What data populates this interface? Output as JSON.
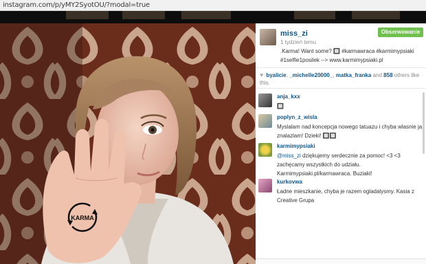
{
  "browser": {
    "url": "instagram.com/p/yMY2SyotOU/?modal=true"
  },
  "post": {
    "username": "miss_zi",
    "time": "1 tydzień temu",
    "follow_label": "Obserwowanie",
    "caption": ".Karma! Want some? 🔲 #karmawraca #karmimypsiaki #1selfie1posilek --> www.karmimypsiaki.pl",
    "palm_text": "KARMA",
    "likes": {
      "users": [
        "byalicie",
        "_michelle20000_",
        "matka_franka"
      ],
      "sep1": ", ",
      "sep2": ", ",
      "and_text": " and ",
      "others_count": "858",
      "others_text": " others like this."
    }
  },
  "comments": [
    {
      "user": "anja_kxx",
      "text": "🔲"
    },
    {
      "user": "poplyn_z_wisla",
      "text": "Myslalam nad koncepcja nowego tatuazu i chyba wlasnie ja znalazlam! Dzieki! 🔲🔲"
    },
    {
      "user": "karmimypsiaki",
      "mention": "@miss_zi",
      "text": " dziękujemy serdecznie za pomoc! <3 <3 zachęcamy wszystkich do udziału. Karmimypsiaki.pl/karmawraca. Buziaki!"
    },
    {
      "user": "kurkovwa",
      "text": "Ładne mieszkanie, chyba je razem ogladalysmy. Kasia z Creative Grupa"
    }
  ]
}
